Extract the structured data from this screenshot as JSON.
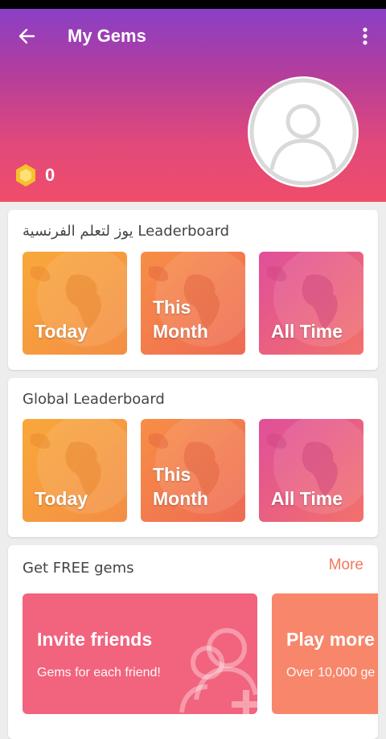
{
  "header": {
    "title": "My Gems",
    "gem_count": "0",
    "back_icon": "arrow-left-icon",
    "menu_icon": "more-vertical-icon",
    "avatar_icon": "user-avatar-icon",
    "gem_icon": "hexagon-gem-icon"
  },
  "course_leaderboard": {
    "title": "يوز لتعلم الفرنسية Leaderboard",
    "tiles": [
      {
        "label": "Today"
      },
      {
        "label_line1": "This",
        "label_line2": "Month"
      },
      {
        "label": "All Time"
      }
    ]
  },
  "global_leaderboard": {
    "title": "Global Leaderboard",
    "tiles": [
      {
        "label": "Today"
      },
      {
        "label_line1": "This",
        "label_line2": "Month"
      },
      {
        "label": "All Time"
      }
    ]
  },
  "free_gems": {
    "title": "Get FREE gems",
    "more_label": "More",
    "cards": [
      {
        "title": "Invite friends",
        "subtitle": "Gems for each friend!",
        "icon": "add-friends-icon"
      },
      {
        "title": "Play more",
        "subtitle": "Over 10,000 ge"
      }
    ]
  },
  "colors": {
    "header_top": "#8a3fc6",
    "header_bottom": "#ef4d6a",
    "tile_orange": "#f6a13a",
    "tile_coral": "#f07255",
    "tile_pink": "#e8528a",
    "more_link": "#f07a5a",
    "invite_card": "#f2637e",
    "play_card": "#f8866a"
  }
}
